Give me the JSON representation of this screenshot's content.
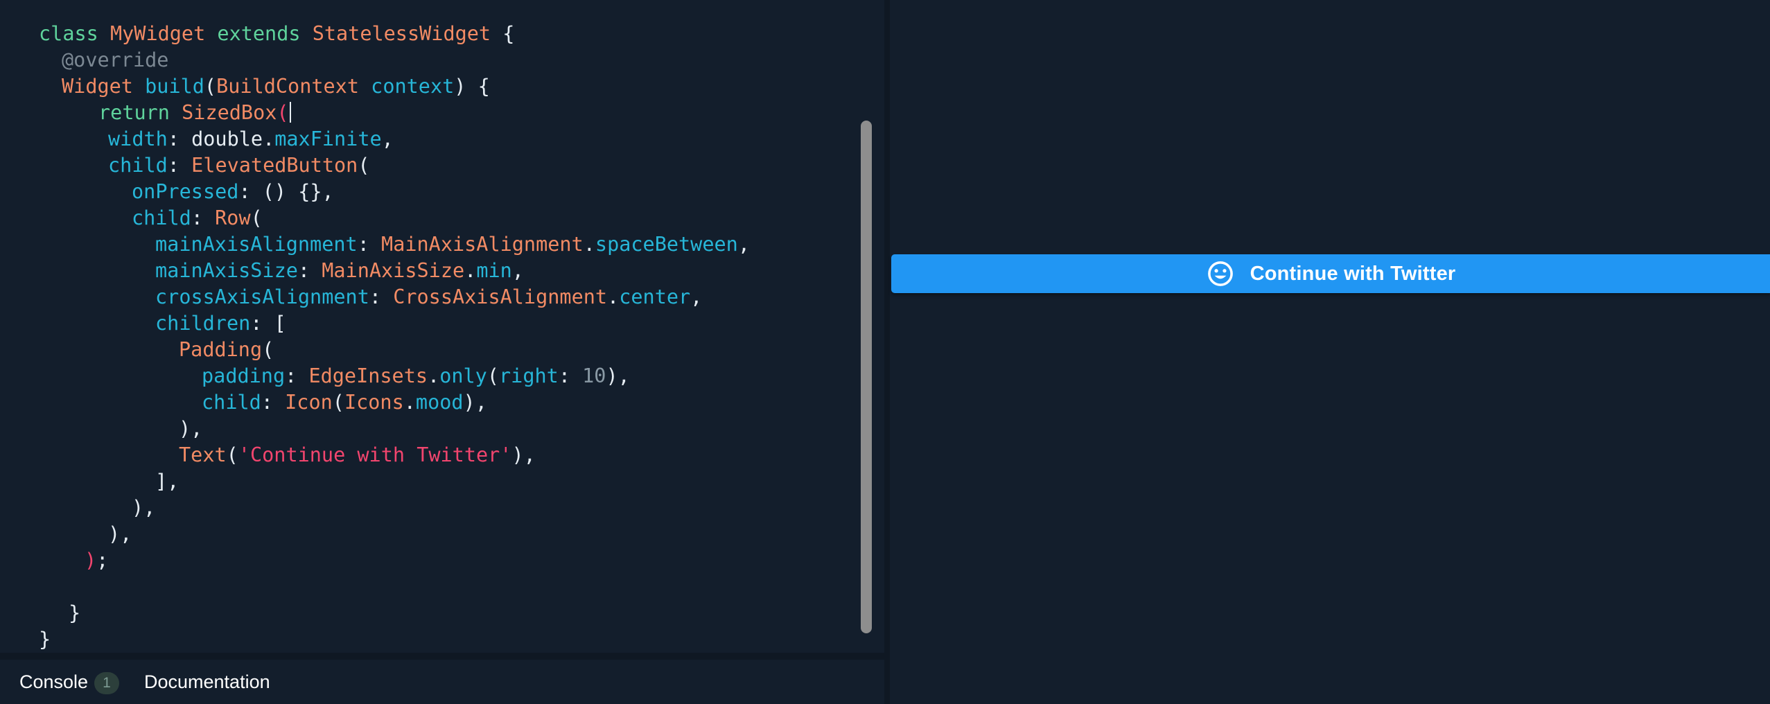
{
  "editor": {
    "lines": {
      "l1": [
        "class",
        "MyWidget",
        "extends",
        "StatelessWidget",
        "{"
      ],
      "l2": [
        "@override"
      ],
      "l3": [
        "Widget",
        "build",
        "(",
        "BuildContext",
        "context",
        ") {"
      ],
      "l4": [
        "return",
        "SizedBox",
        "("
      ],
      "l5": [
        "width",
        ": double.",
        "maxFinite",
        ","
      ],
      "l6": [
        "child",
        ": ",
        "ElevatedButton",
        "("
      ],
      "l7": [
        "onPressed",
        ": () {},"
      ],
      "l8": [
        "child",
        ": ",
        "Row",
        "("
      ],
      "l9": [
        "mainAxisAlignment",
        ": ",
        "MainAxisAlignment",
        ".",
        "spaceBetween",
        ","
      ],
      "l10": [
        "mainAxisSize",
        ": ",
        "MainAxisSize",
        ".",
        "min",
        ","
      ],
      "l11": [
        "crossAxisAlignment",
        ": ",
        "CrossAxisAlignment",
        ".",
        "center",
        ","
      ],
      "l12": [
        "children",
        ": ["
      ],
      "l13": [
        "Padding",
        "("
      ],
      "l14": [
        "padding",
        ": ",
        "EdgeInsets",
        ".",
        "only",
        "(",
        "right",
        ": ",
        "10",
        "),"
      ],
      "l15": [
        "child",
        ": ",
        "Icon",
        "(",
        "Icons",
        ".",
        "mood",
        "),"
      ],
      "l16": [
        "),"
      ],
      "l17": [
        "Text",
        "(",
        "'Continue with Twitter'",
        "),"
      ],
      "l18": [
        "],"
      ],
      "l19": [
        "),"
      ],
      "l20": [
        "),"
      ],
      "l21": [
        ")",
        ";"
      ],
      "l22": [
        ""
      ],
      "l23": [
        "}"
      ],
      "l24": [
        "}"
      ]
    }
  },
  "bottom_bar": {
    "console_label": "Console",
    "console_badge": "1",
    "docs_label": "Documentation"
  },
  "preview": {
    "button_label": "Continue with Twitter",
    "button_icon": "mood-icon",
    "button_color": "#2196f3"
  },
  "colors": {
    "background": "#131e2c",
    "keyword": "#5fd39c",
    "class_name": "#f28b64",
    "property": "#27b6d8",
    "string": "#f2456e",
    "annotation": "#7c8893"
  }
}
